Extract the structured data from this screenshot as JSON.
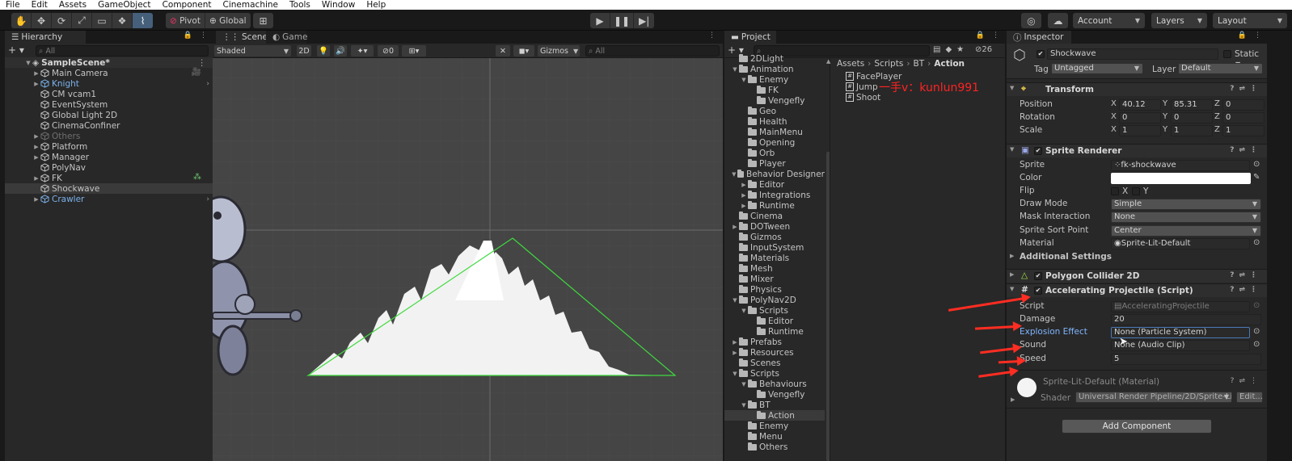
{
  "menu": [
    "File",
    "Edit",
    "Assets",
    "GameObject",
    "Component",
    "Cinemachine",
    "Tools",
    "Window",
    "Help"
  ],
  "toolbar": {
    "pivot": "Pivot",
    "global": "Global",
    "account": "Account",
    "layers": "Layers",
    "layout": "Layout"
  },
  "hierarchy": {
    "tab": "Hierarchy",
    "search_placeholder": "All",
    "scene": "SampleScene*",
    "items": [
      {
        "label": "Main Camera",
        "expandable": true,
        "prefab": false
      },
      {
        "label": "Knight",
        "expandable": true,
        "prefab": true
      },
      {
        "label": "CM vcam1",
        "expandable": false,
        "prefab": false
      },
      {
        "label": "EventSystem",
        "expandable": false,
        "prefab": false
      },
      {
        "label": "Global Light 2D",
        "expandable": false,
        "prefab": false
      },
      {
        "label": "CinemaConfiner",
        "expandable": false,
        "prefab": false
      },
      {
        "label": "Others",
        "expandable": true,
        "prefab": false,
        "dim": true
      },
      {
        "label": "Platform",
        "expandable": true,
        "prefab": false
      },
      {
        "label": "Manager",
        "expandable": true,
        "prefab": false
      },
      {
        "label": "PolyNav",
        "expandable": false,
        "prefab": false
      },
      {
        "label": "FK",
        "expandable": true,
        "prefab": false
      },
      {
        "label": "Shockwave",
        "expandable": false,
        "prefab": false,
        "selected": true
      },
      {
        "label": "Crawler",
        "expandable": true,
        "prefab": true
      }
    ]
  },
  "scene": {
    "tab_scene": "Scene",
    "tab_game": "Game",
    "shading": "Shaded",
    "mode_2d": "2D",
    "hidden_count": "0",
    "gizmos": "Gizmos",
    "search_placeholder": "All"
  },
  "project": {
    "tab": "Project",
    "badge_count": "26",
    "breadcrumb": [
      "Assets",
      "Scripts",
      "BT",
      "Action"
    ],
    "tree": [
      {
        "label": "2DLight",
        "depth": 1,
        "arrow": ""
      },
      {
        "label": "Animation",
        "depth": 1,
        "arrow": "open"
      },
      {
        "label": "Enemy",
        "depth": 2,
        "arrow": "open"
      },
      {
        "label": "FK",
        "depth": 3,
        "arrow": ""
      },
      {
        "label": "Vengefly",
        "depth": 3,
        "arrow": ""
      },
      {
        "label": "Geo",
        "depth": 2,
        "arrow": ""
      },
      {
        "label": "Health",
        "depth": 2,
        "arrow": ""
      },
      {
        "label": "MainMenu",
        "depth": 2,
        "arrow": ""
      },
      {
        "label": "Opening",
        "depth": 2,
        "arrow": ""
      },
      {
        "label": "Orb",
        "depth": 2,
        "arrow": ""
      },
      {
        "label": "Player",
        "depth": 2,
        "arrow": ""
      },
      {
        "label": "Behavior Designer",
        "depth": 1,
        "arrow": "open"
      },
      {
        "label": "Editor",
        "depth": 2,
        "arrow": "closed"
      },
      {
        "label": "Integrations",
        "depth": 2,
        "arrow": "closed"
      },
      {
        "label": "Runtime",
        "depth": 2,
        "arrow": "closed"
      },
      {
        "label": "Cinema",
        "depth": 1,
        "arrow": ""
      },
      {
        "label": "DOTween",
        "depth": 1,
        "arrow": "closed"
      },
      {
        "label": "Gizmos",
        "depth": 1,
        "arrow": ""
      },
      {
        "label": "InputSystem",
        "depth": 1,
        "arrow": ""
      },
      {
        "label": "Materials",
        "depth": 1,
        "arrow": ""
      },
      {
        "label": "Mesh",
        "depth": 1,
        "arrow": ""
      },
      {
        "label": "Mixer",
        "depth": 1,
        "arrow": ""
      },
      {
        "label": "Physics",
        "depth": 1,
        "arrow": ""
      },
      {
        "label": "PolyNav2D",
        "depth": 1,
        "arrow": "open"
      },
      {
        "label": "Scripts",
        "depth": 2,
        "arrow": "open"
      },
      {
        "label": "Editor",
        "depth": 3,
        "arrow": ""
      },
      {
        "label": "Runtime",
        "depth": 3,
        "arrow": ""
      },
      {
        "label": "Prefabs",
        "depth": 1,
        "arrow": "closed"
      },
      {
        "label": "Resources",
        "depth": 1,
        "arrow": "closed"
      },
      {
        "label": "Scenes",
        "depth": 1,
        "arrow": ""
      },
      {
        "label": "Scripts",
        "depth": 1,
        "arrow": "open"
      },
      {
        "label": "Behaviours",
        "depth": 2,
        "arrow": "open"
      },
      {
        "label": "Vengefly",
        "depth": 3,
        "arrow": ""
      },
      {
        "label": "BT",
        "depth": 2,
        "arrow": "open"
      },
      {
        "label": "Action",
        "depth": 3,
        "arrow": "",
        "selected": true
      },
      {
        "label": "Enemy",
        "depth": 2,
        "arrow": ""
      },
      {
        "label": "Menu",
        "depth": 2,
        "arrow": ""
      },
      {
        "label": "Others",
        "depth": 2,
        "arrow": ""
      }
    ],
    "files": [
      "FacePlayer",
      "Jump",
      "Shoot"
    ],
    "watermark": "一手v：kunlun991"
  },
  "inspector": {
    "tab": "Inspector",
    "object_name": "Shockwave",
    "static_label": "Static",
    "tag_label": "Tag",
    "tag_value": "Untagged",
    "layer_label": "Layer",
    "layer_value": "Default",
    "transform": {
      "title": "Transform",
      "position_label": "Position",
      "position": [
        "40.12",
        "85.31",
        "0"
      ],
      "rotation_label": "Rotation",
      "rotation": [
        "0",
        "0",
        "0"
      ],
      "scale_label": "Scale",
      "scale": [
        "1",
        "1",
        "1"
      ]
    },
    "sprite_renderer": {
      "title": "Sprite Renderer",
      "sprite_label": "Sprite",
      "sprite_value": "fk-shockwave",
      "color_label": "Color",
      "color_value": "#ffffff",
      "flip_label": "Flip",
      "flip_x": "X",
      "flip_y": "Y",
      "draw_mode_label": "Draw Mode",
      "draw_mode_value": "Simple",
      "mask_label": "Mask Interaction",
      "mask_value": "None",
      "sort_label": "Sprite Sort Point",
      "sort_value": "Center",
      "material_label": "Material",
      "material_value": "Sprite-Lit-Default",
      "additional": "Additional Settings"
    },
    "polygon_collider": {
      "title": "Polygon Collider 2D"
    },
    "accelerating": {
      "title": "Accelerating Projectile (Script)",
      "script_label": "Script",
      "script_value": "AcceleratingProjectile",
      "damage_label": "Damage",
      "damage_value": "20",
      "explosion_label": "Explosion Effect",
      "explosion_value": "None (Particle System)",
      "sound_label": "Sound",
      "sound_value": "None (Audio Clip)",
      "speed_label": "Speed",
      "speed_value": "5"
    },
    "material_block": {
      "name": "Sprite-Lit-Default (Material)",
      "shader_label": "Shader",
      "shader_value": "Universal Render Pipeline/2D/Sprite-Lit",
      "edit": "Edit..."
    },
    "add_component": "Add Component"
  },
  "colors": {
    "accent_blue": "#46607c",
    "prefab_blue": "#7bb1ea",
    "annotation_red": "#ff2d22",
    "collider_green": "#3fd93f",
    "watermark_red": "#ff2222"
  }
}
